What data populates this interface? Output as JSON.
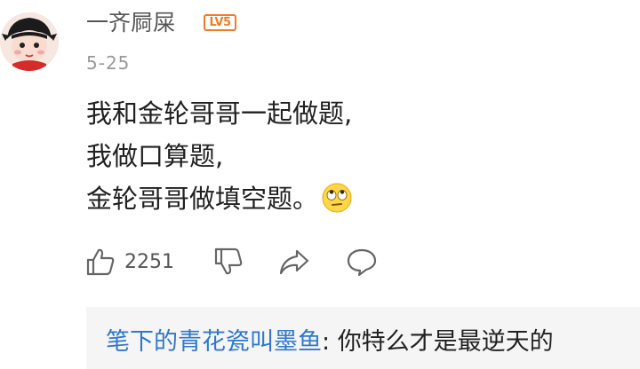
{
  "comment": {
    "username": "一齐屙屎",
    "level_badge": "LV5",
    "date": "5-25",
    "lines": [
      "我和金轮哥哥一起做题,",
      "我做口算题,",
      "金轮哥哥做填空题。"
    ],
    "trailing_emoji": "rolling-eyes-emoji"
  },
  "actions": {
    "like_count": "2251",
    "icons": [
      "thumbs-up-icon",
      "thumbs-down-icon",
      "share-icon",
      "comment-icon"
    ]
  },
  "reply": {
    "author": "笔下的青花瓷叫墨鱼",
    "separator": ": ",
    "text": "你特么才是最逆天的"
  },
  "colors": {
    "username": "#555555",
    "level_badge": "#f27c24",
    "reply_author": "#2f78d0",
    "reply_background": "#f5f5f5"
  }
}
